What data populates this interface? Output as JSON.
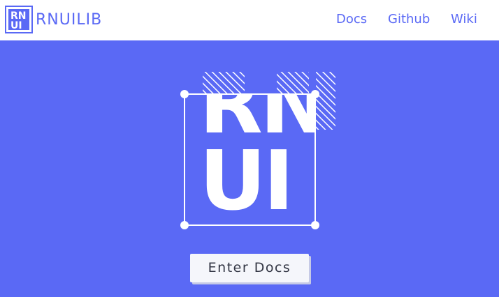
{
  "brand": {
    "logo_text": "RNUI",
    "name": "RNUILIB"
  },
  "nav": {
    "docs": "Docs",
    "github": "Github",
    "wiki": "Wiki"
  },
  "hero": {
    "logo_line1": "RN",
    "logo_line2": "UI"
  },
  "cta": {
    "label": "Enter Docs"
  },
  "colors": {
    "brand": "#5a69f5",
    "background": "#5a69f5",
    "navbar": "#ffffff",
    "button": "#f5f6fb"
  }
}
